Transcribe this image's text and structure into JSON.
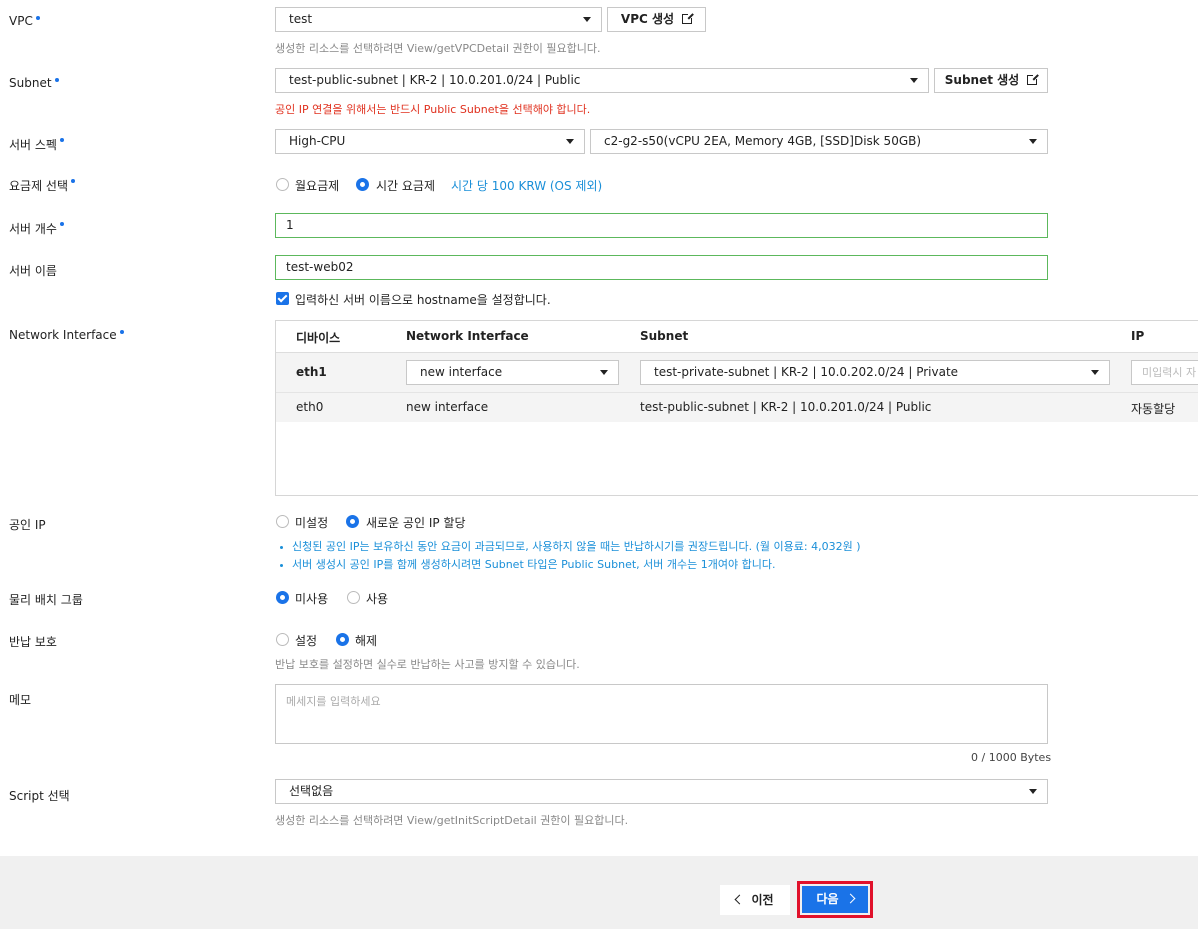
{
  "vpc": {
    "label": "VPC",
    "value": "test",
    "create_btn": "VPC 생성",
    "hint": "생성한 리소스를 선택하려면 View/getVPCDetail 권한이 필요합니다."
  },
  "subnet": {
    "label": "Subnet",
    "value": "test-public-subnet | KR-2 | 10.0.201.0/24 | Public",
    "create_btn": "Subnet 생성",
    "warning": "공인 IP 연결을 위해서는 반드시 Public Subnet을 선택해야 합니다."
  },
  "spec": {
    "label": "서버 스펙",
    "type": "High-CPU",
    "detail": "c2-g2-s50(vCPU 2EA, Memory 4GB, [SSD]Disk 50GB)"
  },
  "billing": {
    "label": "요금제 선택",
    "monthly": "월요금제",
    "hourly": "시간 요금제",
    "price": "시간 당 100 KRW (OS 제외)",
    "selected": "hourly"
  },
  "count": {
    "label": "서버 개수",
    "value": "1"
  },
  "name": {
    "label": "서버 이름",
    "value": "test-web02",
    "hostname_check": "입력하신 서버 이름으로 hostname을 설정합니다."
  },
  "network": {
    "label": "Network Interface",
    "headers": [
      "디바이스",
      "Network Interface",
      "Subnet",
      "IP"
    ],
    "row1": {
      "device": "eth1",
      "interface": "new interface",
      "subnet": "test-private-subnet | KR-2 | 10.0.202.0/24 | Private",
      "ip_placeholder": "미입력시 자"
    },
    "row2": {
      "device": "eth0",
      "interface": "new interface",
      "subnet": "test-public-subnet | KR-2 | 10.0.201.0/24 | Public",
      "ip": "자동할당"
    }
  },
  "public_ip": {
    "label": "공인 IP",
    "opt_none": "미설정",
    "opt_new": "새로운 공인 IP 할당",
    "selected": "new",
    "notes": [
      "신청된 공인 IP는 보유하신 동안 요금이 과금되므로, 사용하지 않을 때는 반납하시기를 권장드립니다. (월 이용료: 4,032원 )",
      "서버 생성시 공인 IP를 함께 생성하시려면 Subnet 타입은 Public Subnet, 서버 개수는 1개여야 합니다."
    ]
  },
  "placement": {
    "label": "물리 배치 그룹",
    "opt_off": "미사용",
    "opt_on": "사용",
    "selected": "off"
  },
  "protect": {
    "label": "반납 보호",
    "opt_set": "설정",
    "opt_unset": "해제",
    "selected": "unset",
    "hint": "반납 보호를 설정하면 실수로 반납하는 사고를 방지할 수 있습니다."
  },
  "memo": {
    "label": "메모",
    "placeholder": "메세지를 입력하세요",
    "counter": "0 / 1000 Bytes"
  },
  "script": {
    "label": "Script 선택",
    "value": "선택없음",
    "hint": "생성한 리소스를 선택하려면 View/getInitScriptDetail 권한이 필요합니다."
  },
  "footer": {
    "prev": "이전",
    "next": "다음"
  },
  "colors": {
    "accent": "#1a73e8",
    "warning": "#e0301e",
    "highlight": "#e0112b",
    "valid_border": "#5cb85c"
  }
}
